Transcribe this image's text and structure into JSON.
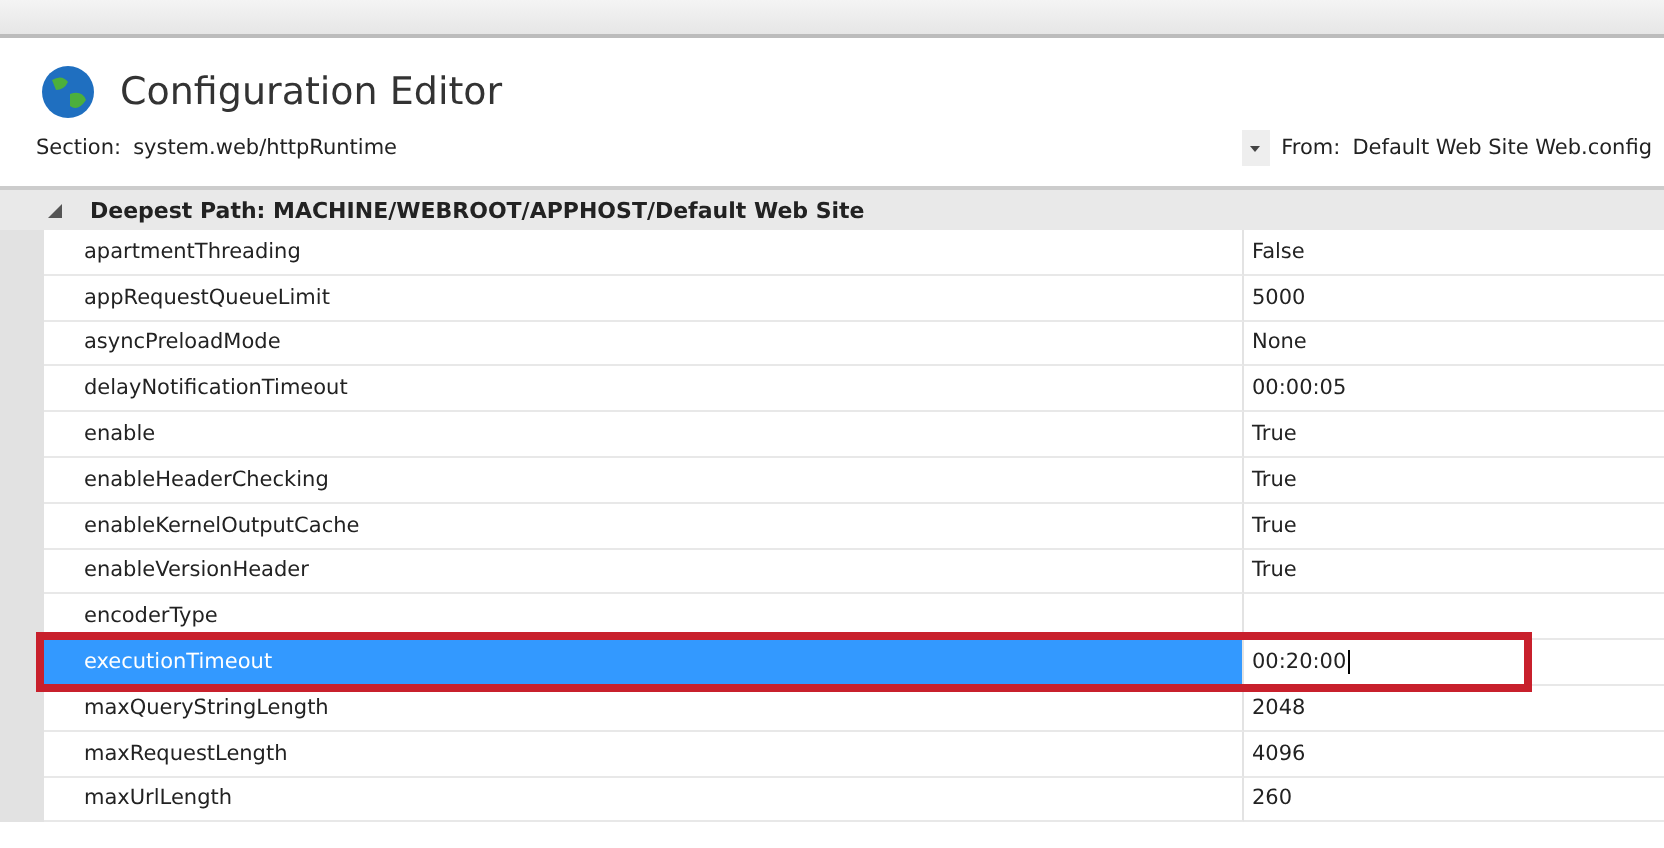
{
  "title": "Configuration Editor",
  "section": {
    "label": "Section:",
    "value": "system.web/httpRuntime"
  },
  "from": {
    "label": "From:",
    "value": "Default Web Site Web.config"
  },
  "group": {
    "expanded": true,
    "label": "Deepest Path: MACHINE/WEBROOT/APPHOST/Default Web Site"
  },
  "rows": [
    {
      "name": "apartmentThreading",
      "value": "False",
      "selected": false
    },
    {
      "name": "appRequestQueueLimit",
      "value": "5000",
      "selected": false
    },
    {
      "name": "asyncPreloadMode",
      "value": "None",
      "selected": false
    },
    {
      "name": "delayNotificationTimeout",
      "value": "00:00:05",
      "selected": false
    },
    {
      "name": "enable",
      "value": "True",
      "selected": false
    },
    {
      "name": "enableHeaderChecking",
      "value": "True",
      "selected": false
    },
    {
      "name": "enableKernelOutputCache",
      "value": "True",
      "selected": false
    },
    {
      "name": "enableVersionHeader",
      "value": "True",
      "selected": false
    },
    {
      "name": "encoderType",
      "value": "",
      "selected": false
    },
    {
      "name": "executionTimeout",
      "value": "00:20:00",
      "selected": true,
      "highlighted": true
    },
    {
      "name": "maxQueryStringLength",
      "value": "2048",
      "selected": false
    },
    {
      "name": "maxRequestLength",
      "value": "4096",
      "selected": false
    },
    {
      "name": "maxUrlLength",
      "value": "260",
      "selected": false
    }
  ]
}
